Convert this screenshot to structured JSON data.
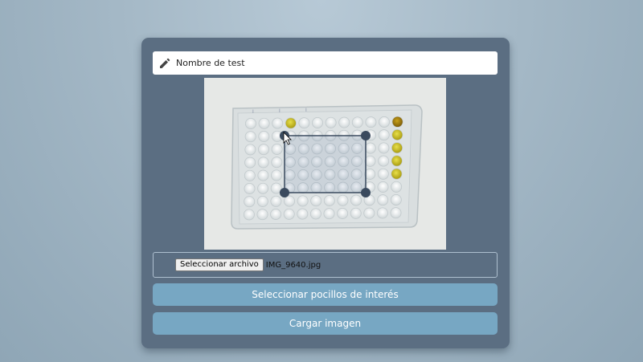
{
  "test_name": {
    "placeholder": "Nombre de test",
    "icon": "pencil-icon"
  },
  "image_preview": {
    "description_icon": "well-plate-photo"
  },
  "file_input": {
    "button_label": "Seleccionar archivo",
    "file_name": "IMG_9640.jpg"
  },
  "buttons": {
    "select_wells": "Seleccionar pocillos de interés",
    "load_image": "Cargar imagen"
  },
  "colors": {
    "card": "#5b6e82",
    "button": "#77a7c3",
    "handle": "#3a4a5e"
  }
}
